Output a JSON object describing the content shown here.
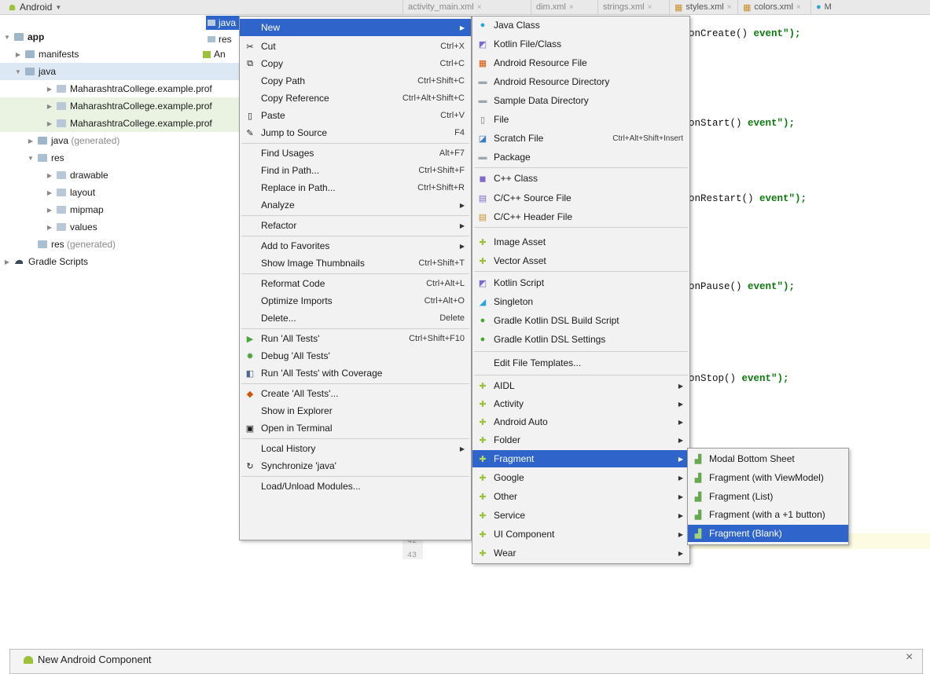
{
  "project_view": {
    "label": "Android"
  },
  "editor_tabs": [
    {
      "label": "activity_main.xml"
    },
    {
      "label": "dim.xml"
    },
    {
      "label": "strings.xml"
    },
    {
      "label": "styles.xml"
    },
    {
      "label": "colors.xml"
    },
    {
      "label": "M"
    }
  ],
  "tree": [
    {
      "label": "app",
      "bold": true
    },
    {
      "label": "manifests"
    },
    {
      "label": "java"
    },
    {
      "label": "MaharashtraCollege.example.prof"
    },
    {
      "label": "MaharashtraCollege.example.prof"
    },
    {
      "label": "MaharashtraCollege.example.prof"
    },
    {
      "label": "java",
      "suffix": "(generated)"
    },
    {
      "label": "res"
    },
    {
      "label": "drawable"
    },
    {
      "label": "layout"
    },
    {
      "label": "mipmap"
    },
    {
      "label": "values"
    },
    {
      "label": "res",
      "suffix": "(generated)"
    },
    {
      "label": "Gradle Scripts"
    }
  ],
  "mid_column": [
    {
      "label": "java"
    },
    {
      "label": "res"
    },
    {
      "label": "An"
    }
  ],
  "editor_code": [
    {
      "method": "onCreate() ",
      "str": "event\");"
    },
    {
      "method": "onStart() ",
      "str": "event\");"
    },
    {
      "method": "onRestart() ",
      "str": "event\");"
    },
    {
      "method": "onPause() ",
      "str": "event\");"
    },
    {
      "method": "onStop() ",
      "str": "event\");"
    }
  ],
  "gutter_lines": [
    "42",
    "43"
  ],
  "context_menu": {
    "items": [
      {
        "label": "New",
        "shortcut": "",
        "submenu": true,
        "active": true
      },
      {
        "label": "Cut",
        "shortcut": "Ctrl+X",
        "icon": "scissors-icon"
      },
      {
        "label": "Copy",
        "shortcut": "Ctrl+C",
        "icon": "copy-icon"
      },
      {
        "label": "Copy Path",
        "shortcut": "Ctrl+Shift+C"
      },
      {
        "label": "Copy Reference",
        "shortcut": "Ctrl+Alt+Shift+C"
      },
      {
        "label": "Paste",
        "shortcut": "Ctrl+V",
        "icon": "paste-icon"
      },
      {
        "label": "Jump to Source",
        "shortcut": "F4",
        "icon": "pencil-icon"
      },
      {
        "label": "Find Usages",
        "shortcut": "Alt+F7"
      },
      {
        "label": "Find in Path...",
        "shortcut": "Ctrl+Shift+F"
      },
      {
        "label": "Replace in Path...",
        "shortcut": "Ctrl+Shift+R"
      },
      {
        "label": "Analyze",
        "shortcut": "",
        "submenu": true
      },
      {
        "label": "Refactor",
        "shortcut": "",
        "submenu": true
      },
      {
        "label": "Add to Favorites",
        "shortcut": "",
        "submenu": true
      },
      {
        "label": "Show Image Thumbnails",
        "shortcut": "Ctrl+Shift+T"
      },
      {
        "label": "Reformat Code",
        "shortcut": "Ctrl+Alt+L"
      },
      {
        "label": "Optimize Imports",
        "shortcut": "Ctrl+Alt+O"
      },
      {
        "label": "Delete...",
        "shortcut": "Delete"
      },
      {
        "label": "Run 'All Tests'",
        "shortcut": "Ctrl+Shift+F10",
        "icon": "run-icon"
      },
      {
        "label": "Debug 'All Tests'",
        "shortcut": "",
        "icon": "debug-icon"
      },
      {
        "label": "Run 'All Tests' with Coverage",
        "shortcut": "",
        "icon": "coverage-icon"
      },
      {
        "label": "Create 'All Tests'...",
        "shortcut": "",
        "icon": "create-test-icon"
      },
      {
        "label": "Show in Explorer",
        "shortcut": ""
      },
      {
        "label": "Open in Terminal",
        "shortcut": "",
        "icon": "terminal-icon"
      },
      {
        "label": "Local History",
        "shortcut": "",
        "submenu": true
      },
      {
        "label": "Synchronize 'java'",
        "shortcut": "",
        "icon": "sync-icon"
      },
      {
        "label": "Load/Unload Modules...",
        "shortcut": ""
      }
    ]
  },
  "new_submenu": {
    "items": [
      {
        "label": "Java Class",
        "icon": "java-class-icon"
      },
      {
        "label": "Kotlin File/Class",
        "icon": "kotlin-icon"
      },
      {
        "label": "Android Resource File",
        "icon": "resource-file-icon"
      },
      {
        "label": "Android Resource Directory",
        "icon": "folder-icon"
      },
      {
        "label": "Sample Data Directory",
        "icon": "folder-icon"
      },
      {
        "label": "File",
        "icon": "file-icon"
      },
      {
        "label": "Scratch File",
        "shortcut": "Ctrl+Alt+Shift+Insert",
        "icon": "scratch-icon"
      },
      {
        "label": "Package",
        "icon": "package-icon"
      },
      {
        "label": "C++ Class",
        "icon": "cpp-class-icon"
      },
      {
        "label": "C/C++ Source File",
        "icon": "cpp-source-icon"
      },
      {
        "label": "C/C++ Header File",
        "icon": "cpp-header-icon"
      },
      {
        "label": "Image Asset",
        "icon": "android-icon"
      },
      {
        "label": "Vector Asset",
        "icon": "android-icon"
      },
      {
        "label": "Kotlin Script",
        "icon": "kotlin-icon"
      },
      {
        "label": "Singleton",
        "icon": "singleton-icon"
      },
      {
        "label": "Gradle Kotlin DSL Build Script",
        "icon": "gradle-kotlin-icon"
      },
      {
        "label": "Gradle Kotlin DSL Settings",
        "icon": "gradle-kotlin-icon"
      },
      {
        "label": "Edit File Templates..."
      },
      {
        "label": "AIDL",
        "submenu": true,
        "icon": "android-icon"
      },
      {
        "label": "Activity",
        "submenu": true,
        "icon": "android-icon"
      },
      {
        "label": "Android Auto",
        "submenu": true,
        "icon": "android-icon"
      },
      {
        "label": "Folder",
        "submenu": true,
        "icon": "android-icon"
      },
      {
        "label": "Fragment",
        "submenu": true,
        "icon": "android-icon",
        "active": true
      },
      {
        "label": "Google",
        "submenu": true,
        "icon": "android-icon"
      },
      {
        "label": "Other",
        "submenu": true,
        "icon": "android-icon"
      },
      {
        "label": "Service",
        "submenu": true,
        "icon": "android-icon"
      },
      {
        "label": "UI Component",
        "submenu": true,
        "icon": "android-icon"
      },
      {
        "label": "Wear",
        "submenu": true,
        "icon": "android-icon"
      }
    ]
  },
  "fragment_submenu": {
    "items": [
      {
        "label": "Modal Bottom Sheet"
      },
      {
        "label": "Fragment (with ViewModel)"
      },
      {
        "label": "Fragment (List)"
      },
      {
        "label": "Fragment (with a +1 button)"
      },
      {
        "label": "Fragment (Blank)",
        "active": true
      }
    ]
  },
  "dialog": {
    "title": "New Android Component",
    "close": "×"
  },
  "colors": {
    "accent": "#2f65ca",
    "android_green": "#9cc23b",
    "menu_bg": "#f2f2f2"
  }
}
